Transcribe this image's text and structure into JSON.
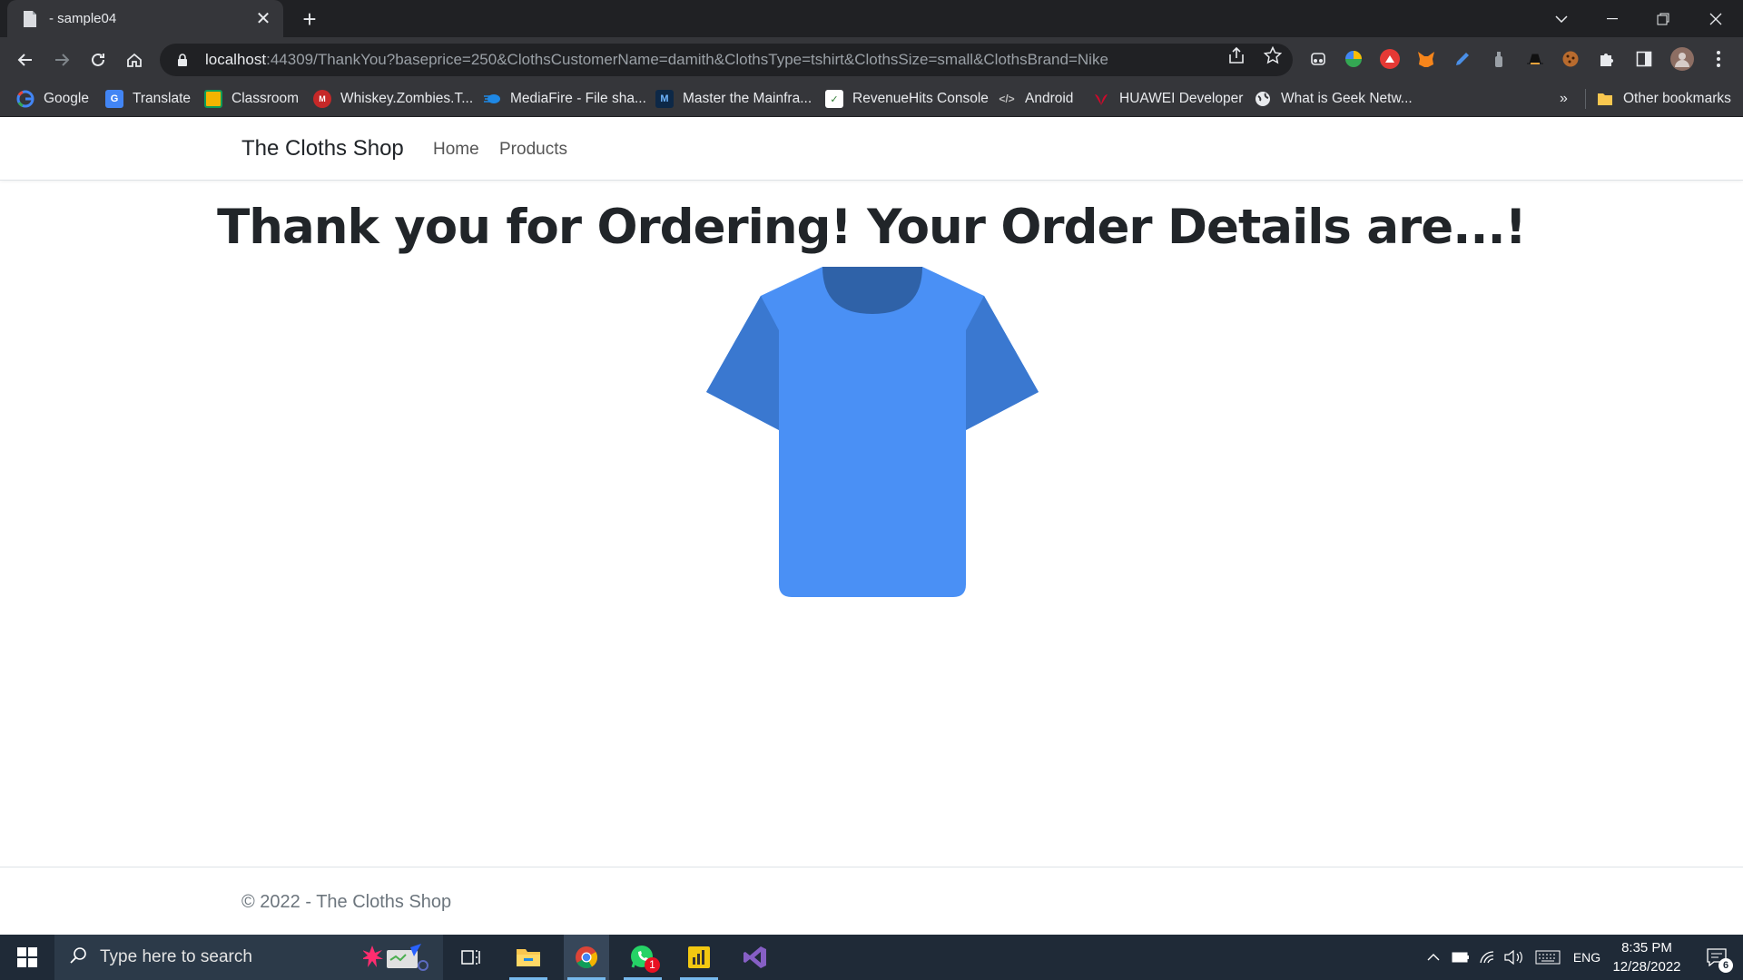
{
  "browser": {
    "tab_title": "- sample04",
    "url_host": "localhost",
    "url_rest": ":44309/ThankYou?baseprice=250&ClothsCustomerName=damith&ClothsType=tshirt&ClothsSize=small&ClothsBrand=Nike",
    "bookmarks": [
      "Google",
      "Translate",
      "Classroom",
      "Whiskey.Zombies.T...",
      "MediaFire - File sha...",
      "Master the Mainfra...",
      "RevenueHits Console",
      "Android",
      "HUAWEI Developer",
      "What is Geek Netw..."
    ],
    "overflow": "»",
    "other_bookmarks": "Other bookmarks"
  },
  "site": {
    "brand": "The Cloths Shop",
    "nav": [
      "Home",
      "Products"
    ],
    "heading": "Thank you for Ordering! Your Order Details are...!",
    "footer": "© 2022 - The Cloths Shop",
    "product_image": "tshirt-icon"
  },
  "taskbar": {
    "search_placeholder": "Type here to search",
    "language": "ENG",
    "time": "8:35 PM",
    "date": "12/28/2022",
    "notification_count": "6",
    "whatsapp_badge": "1"
  },
  "colors": {
    "shirt_body": "#4a90f5",
    "shirt_shade": "#3a78d0",
    "shirt_collar": "#2f62a8",
    "taskbar": "#1f2a37",
    "chrome_dark": "#202124",
    "chrome_toolbar": "#35363a"
  }
}
